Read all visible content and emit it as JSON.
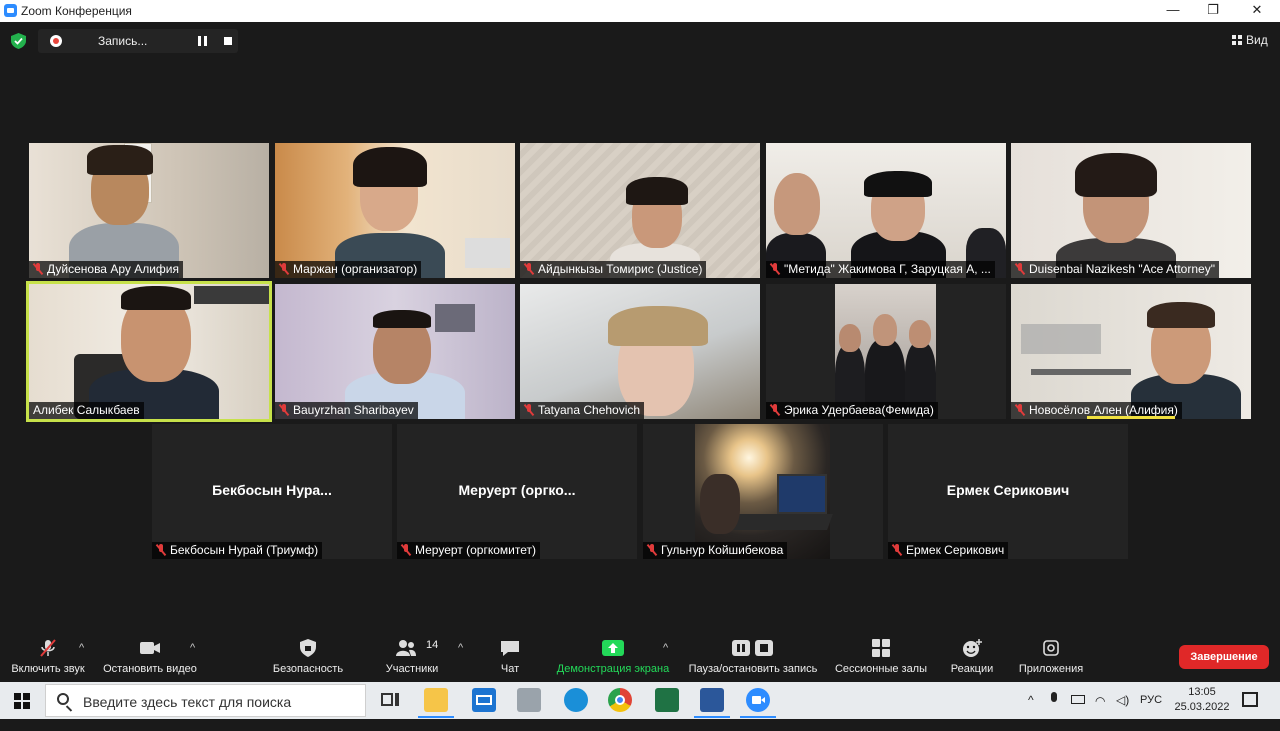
{
  "window": {
    "title": "Zoom Конференция",
    "minimize": "—",
    "maximize": "❐",
    "close": "✕"
  },
  "recording": {
    "label": "Запись..."
  },
  "view": {
    "label": "Вид"
  },
  "participants": [
    {
      "name": "Дуйсенова Ару Алифия",
      "muted": true,
      "video": true
    },
    {
      "name": "Маржан (организатор)",
      "muted": true,
      "video": true
    },
    {
      "name": "Айдынкызы Томирис (Justice)",
      "muted": true,
      "video": true
    },
    {
      "name": "\"Метида\" Жакимова Г, Заруцкая А, ...",
      "muted": true,
      "video": true
    },
    {
      "name": "Duisenbai Nazikesh \"Ace Attorney\"",
      "muted": true,
      "video": true
    },
    {
      "name": "Алибек Салыкбаев",
      "muted": false,
      "video": true,
      "active_speaker": true
    },
    {
      "name": "Bauyrzhan Sharibayev",
      "muted": true,
      "video": true
    },
    {
      "name": "Tatyana Chehovich",
      "muted": true,
      "video": true
    },
    {
      "name": "Эрика Удербаева(Фемида)",
      "muted": true,
      "video": true
    },
    {
      "name": "Новосёлов Ален (Алифия)",
      "muted": true,
      "video": true
    },
    {
      "name": "Бекбосын Нурай (Триумф)",
      "display": "Бекбосын  Нура...",
      "muted": true,
      "video": false
    },
    {
      "name": "Меруерт (оргкомитет)",
      "display": "Меруерт  (оргко...",
      "muted": true,
      "video": false
    },
    {
      "name": "Гульнур Койшибекова",
      "muted": true,
      "video": true
    },
    {
      "name": "Ермек Серикович",
      "display": "Ермек Серикович",
      "muted": true,
      "video": false
    }
  ],
  "toolbar": {
    "unmute": "Включить звук",
    "stop_video": "Остановить видео",
    "security": "Безопасность",
    "participants": "Участники",
    "participants_count": "14",
    "chat": "Чат",
    "share_screen": "Демонстрация экрана",
    "pause_recording": "Пауза/остановить запись",
    "breakout_rooms": "Сессионные залы",
    "reactions": "Реакции",
    "apps": "Приложения",
    "end": "Завершение",
    "share_color": "#23d959",
    "end_color": "#e02828"
  },
  "taskbar": {
    "search_placeholder": "Введите здесь текст для поиска",
    "apps": [
      "task-view-icon",
      "file-explorer-icon",
      "mail-icon",
      "printer-icon",
      "edge-icon",
      "chrome-icon",
      "excel-icon",
      "word-icon",
      "zoom-icon"
    ],
    "language": "РУС",
    "time": "13:05",
    "date": "25.03.2022"
  }
}
